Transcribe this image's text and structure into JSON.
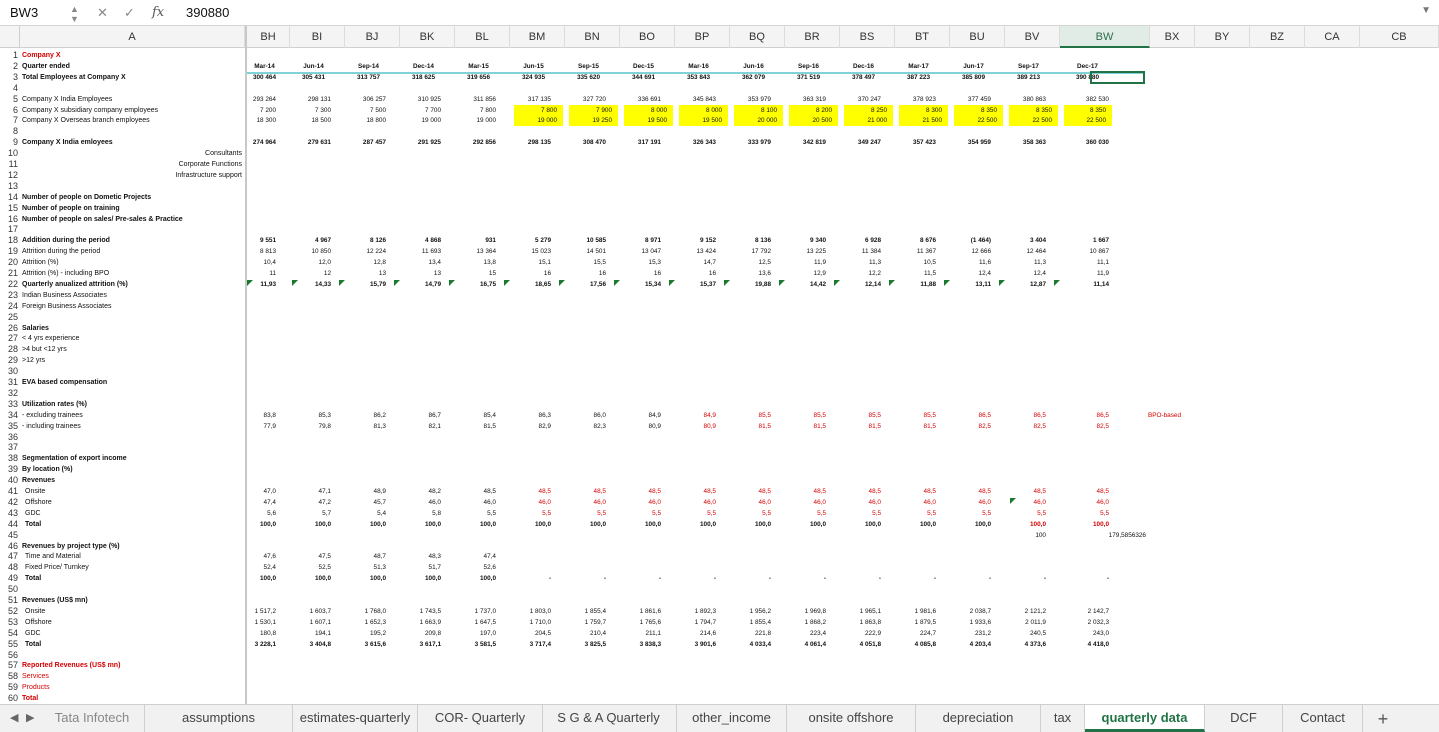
{
  "formula_bar": {
    "name_box": "BW3",
    "formula_value": "390880",
    "fx_label": "fx"
  },
  "columns": [
    "A",
    "BH",
    "BI",
    "BJ",
    "BK",
    "BL",
    "BM",
    "BN",
    "BO",
    "BP",
    "BQ",
    "BR",
    "BS",
    "BT",
    "BU",
    "BV",
    "BW",
    "BX",
    "BY",
    "BZ",
    "CA",
    "CB"
  ],
  "selected_column": "BW",
  "rows": [
    {
      "n": "1",
      "label": "Company X",
      "lstyle": "bold red",
      "v": []
    },
    {
      "n": "2",
      "label": "Quarter ended",
      "lstyle": "bold",
      "vstyle": "bold ctr",
      "v": [
        "Mar-14",
        "Jun-14",
        "Sep-14",
        "Dec-14",
        "Mar-15",
        "Jun-15",
        "Sep-15",
        "Dec-15",
        "Mar-16",
        "Jun-16",
        "Sep-16",
        "Dec-16",
        "Mar-17",
        "Jun-17",
        "Sep-17",
        "Dec-17"
      ]
    },
    {
      "n": "3",
      "label": "Total Employees at Company X",
      "lstyle": "bold",
      "vstyle": "bold ctr",
      "v": [
        "300 464",
        "305 431",
        "313 757",
        "318 625",
        "319 656",
        "324 935",
        "335 620",
        "344 691",
        "353 843",
        "362 079",
        "371 519",
        "378 497",
        "387 223",
        "385 809",
        "389 213",
        "390 880"
      ]
    },
    {
      "n": "4",
      "label": "",
      "v": []
    },
    {
      "n": "5",
      "label": "Company X India Employees",
      "v": [
        "293 264",
        "298 131",
        "306 257",
        "310 925",
        "311 856",
        "317 135",
        "327 720",
        "336 691",
        "345 843",
        "353 979",
        "363 319",
        "370 247",
        "378 923",
        "377 459",
        "380 863",
        "382 530"
      ]
    },
    {
      "n": "6",
      "label": "Company X subsidiary company employees",
      "v": [
        "7 200",
        "7 300",
        "7 500",
        "7 700",
        "7 800",
        "7 800",
        "7 900",
        "8 000",
        "8 000",
        "8 100",
        "8 200",
        "8 250",
        "8 300",
        "8 350",
        "8 350",
        "8 350"
      ],
      "yel_from": 5
    },
    {
      "n": "7",
      "label": "Company X Overseas branch employees",
      "v": [
        "18 300",
        "18 500",
        "18 800",
        "19 000",
        "19 000",
        "19 000",
        "19 250",
        "19 500",
        "19 500",
        "20 000",
        "20 500",
        "21 000",
        "21 500",
        "22 500",
        "22 500",
        "22 500"
      ],
      "yel_from": 5
    },
    {
      "n": "8",
      "label": "",
      "v": []
    },
    {
      "n": "9",
      "label": "Company X India emloyees",
      "lstyle": "bold",
      "vstyle": "bold",
      "v": [
        "274 964",
        "279 631",
        "287 457",
        "291 925",
        "292 856",
        "298 135",
        "308 470",
        "317 191",
        "326 343",
        "333 979",
        "342 819",
        "349 247",
        "357 423",
        "354 959",
        "358 363",
        "360 030"
      ]
    },
    {
      "n": "10",
      "label": "Consultants",
      "lstyle": "right",
      "v": []
    },
    {
      "n": "11",
      "label": "Corporate Functions",
      "lstyle": "right",
      "v": []
    },
    {
      "n": "12",
      "label": "Infrastructure support",
      "lstyle": "right",
      "v": []
    },
    {
      "n": "13",
      "label": "",
      "v": []
    },
    {
      "n": "14",
      "label": "Number of people on Dometic Projects",
      "lstyle": "bold",
      "v": []
    },
    {
      "n": "15",
      "label": "Number of people on training",
      "lstyle": "bold",
      "v": []
    },
    {
      "n": "16",
      "label": "Number of people on sales/ Pre-sales & Practice",
      "lstyle": "bold",
      "v": []
    },
    {
      "n": "17",
      "label": "",
      "v": []
    },
    {
      "n": "18",
      "label": "Addition during the period",
      "lstyle": "bold",
      "vstyle": "bold",
      "v": [
        "9 551",
        "4 967",
        "8 126",
        "4 868",
        "931",
        "5 279",
        "10 585",
        "8 971",
        "9 152",
        "8 136",
        "9 340",
        "6 928",
        "8 676",
        "(1 464)",
        "3 404",
        "1 667"
      ]
    },
    {
      "n": "19",
      "label": "Attrition during the period",
      "v": [
        "8 813",
        "10 850",
        "12 224",
        "11 693",
        "13 364",
        "15 023",
        "14 501",
        "13 047",
        "13 424",
        "17 792",
        "13 225",
        "11 384",
        "11 367",
        "12 666",
        "12 464",
        "10 867"
      ]
    },
    {
      "n": "20",
      "label": "Attrition (%)",
      "v": [
        "10,4",
        "12,0",
        "12,8",
        "13,4",
        "13,8",
        "15,1",
        "15,5",
        "15,3",
        "14,7",
        "12,5",
        "11,9",
        "11,3",
        "10,5",
        "11,6",
        "11,3",
        "11,1"
      ]
    },
    {
      "n": "21",
      "label": "Attrition (%) - including BPO",
      "v": [
        "11",
        "12",
        "13",
        "13",
        "15",
        "16",
        "16",
        "16",
        "16",
        "13,6",
        "12,9",
        "12,2",
        "11,5",
        "12,4",
        "12,4",
        "11,9"
      ]
    },
    {
      "n": "22",
      "label": "Quarterly anualized attrition (%)",
      "lstyle": "bold",
      "vstyle": "bold",
      "v": [
        "11,93",
        "14,33",
        "15,79",
        "14,79",
        "16,75",
        "18,65",
        "17,56",
        "15,34",
        "15,37",
        "19,88",
        "14,42",
        "12,14",
        "11,88",
        "13,11",
        "12,87",
        "11,14"
      ],
      "tri": true
    },
    {
      "n": "23",
      "label": "Indian Business Associates",
      "v": []
    },
    {
      "n": "24",
      "label": "Foreign Business Associates",
      "v": []
    },
    {
      "n": "25",
      "label": "",
      "v": []
    },
    {
      "n": "26",
      "label": "Salaries",
      "lstyle": "bold",
      "v": []
    },
    {
      "n": "27",
      "label": "< 4 yrs experience",
      "v": []
    },
    {
      "n": "28",
      "label": ">4 but <12 yrs",
      "v": []
    },
    {
      "n": "29",
      "label": ">12 yrs",
      "v": []
    },
    {
      "n": "30",
      "label": "",
      "v": []
    },
    {
      "n": "31",
      "label": "EVA based compensation",
      "lstyle": "bold",
      "v": []
    },
    {
      "n": "32",
      "label": "",
      "v": []
    },
    {
      "n": "33",
      "label": "Utilization rates (%)",
      "lstyle": "bold",
      "v": []
    },
    {
      "n": "34",
      "label": " - excluding trainees",
      "v": [
        "83,8",
        "85,3",
        "86,2",
        "86,7",
        "85,4",
        "86,3",
        "86,0",
        "84,9",
        "84,9",
        "85,5",
        "85,5",
        "85,5",
        "85,5",
        "86,5",
        "86,5",
        "86,5"
      ],
      "red_from": 8,
      "extra": "BPO-based"
    },
    {
      "n": "35",
      "label": " - including trainees",
      "v": [
        "77,9",
        "79,8",
        "81,3",
        "82,1",
        "81,5",
        "82,9",
        "82,3",
        "80,9",
        "80,9",
        "81,5",
        "81,5",
        "81,5",
        "81,5",
        "82,5",
        "82,5",
        "82,5"
      ],
      "red_from": 8
    },
    {
      "n": "36",
      "label": "",
      "v": []
    },
    {
      "n": "37",
      "label": "",
      "v": []
    },
    {
      "n": "38",
      "label": "Segmentation of export income",
      "lstyle": "bold",
      "v": []
    },
    {
      "n": "39",
      "label": "By location (%)",
      "lstyle": "bold",
      "v": []
    },
    {
      "n": "40",
      "label": "Revenues",
      "lstyle": "bold",
      "v": []
    },
    {
      "n": "41",
      "label": "Onsite",
      "lstyle": "ind",
      "v": [
        "47,0",
        "47,1",
        "48,9",
        "48,2",
        "48,5",
        "48,5",
        "48,5",
        "48,5",
        "48,5",
        "48,5",
        "48,5",
        "48,5",
        "48,5",
        "48,5",
        "48,5",
        "48,5"
      ],
      "red_from": 5
    },
    {
      "n": "42",
      "label": "Offshore",
      "lstyle": "ind",
      "v": [
        "47,4",
        "47,2",
        "45,7",
        "46,0",
        "46,0",
        "46,0",
        "46,0",
        "46,0",
        "46,0",
        "46,0",
        "46,0",
        "46,0",
        "46,0",
        "46,0",
        "46,0",
        "46,0"
      ],
      "red_from": 5
    },
    {
      "n": "43",
      "label": "GDC",
      "lstyle": "ind",
      "v": [
        "5,6",
        "5,7",
        "5,4",
        "5,8",
        "5,5",
        "5,5",
        "5,5",
        "5,5",
        "5,5",
        "5,5",
        "5,5",
        "5,5",
        "5,5",
        "5,5",
        "5,5",
        "5,5"
      ],
      "red_from": 5
    },
    {
      "n": "44",
      "label": "Total",
      "lstyle": "bold ind",
      "vstyle": "bold",
      "v": [
        "100,0",
        "100,0",
        "100,0",
        "100,0",
        "100,0",
        "100,0",
        "100,0",
        "100,0",
        "100,0",
        "100,0",
        "100,0",
        "100,0",
        "100,0",
        "100,0",
        "100,0",
        "100,0"
      ],
      "red_from": 14
    },
    {
      "n": "45",
      "label": "",
      "v": [
        "",
        "",
        "",
        "",
        "",
        "",
        "",
        "",
        "",
        "",
        "",
        "",
        "",
        "",
        "100",
        "179,5856326"
      ]
    },
    {
      "n": "46",
      "label": "Revenues by project type (%)",
      "lstyle": "bold",
      "v": []
    },
    {
      "n": "47",
      "label": "Time and Material",
      "lstyle": "ind",
      "v": [
        "47,6",
        "47,5",
        "48,7",
        "48,3",
        "47,4"
      ]
    },
    {
      "n": "48",
      "label": "Fixed Price/ Turnkey",
      "lstyle": "ind",
      "v": [
        "52,4",
        "52,5",
        "51,3",
        "51,7",
        "52,6"
      ]
    },
    {
      "n": "49",
      "label": "Total",
      "lstyle": "bold ind",
      "vstyle": "bold",
      "v": [
        "100,0",
        "100,0",
        "100,0",
        "100,0",
        "100,0",
        "-",
        "-",
        "-",
        "-",
        "-",
        "-",
        "-",
        "-",
        "-",
        "-",
        "-"
      ]
    },
    {
      "n": "50",
      "label": "",
      "v": []
    },
    {
      "n": "51",
      "label": "Revenues (US$ mn)",
      "lstyle": "bold",
      "v": []
    },
    {
      "n": "52",
      "label": "Onsite",
      "lstyle": "ind",
      "v": [
        "1 517,2",
        "1 603,7",
        "1 768,0",
        "1 743,5",
        "1 737,0",
        "1 803,0",
        "1 855,4",
        "1 861,6",
        "1 892,3",
        "1 956,2",
        "1 969,8",
        "1 965,1",
        "1 981,6",
        "2 038,7",
        "2 121,2",
        "2 142,7"
      ]
    },
    {
      "n": "53",
      "label": "Offshore",
      "lstyle": "ind",
      "v": [
        "1 530,1",
        "1 607,1",
        "1 652,3",
        "1 663,9",
        "1 647,5",
        "1 710,0",
        "1 759,7",
        "1 765,6",
        "1 794,7",
        "1 855,4",
        "1 868,2",
        "1 863,8",
        "1 879,5",
        "1 933,6",
        "2 011,9",
        "2 032,3"
      ]
    },
    {
      "n": "54",
      "label": "GDC",
      "lstyle": "ind",
      "v": [
        "180,8",
        "194,1",
        "195,2",
        "209,8",
        "197,0",
        "204,5",
        "210,4",
        "211,1",
        "214,6",
        "221,8",
        "223,4",
        "222,9",
        "224,7",
        "231,2",
        "240,5",
        "243,0"
      ]
    },
    {
      "n": "55",
      "label": "Total",
      "lstyle": "bold ind",
      "vstyle": "bold",
      "v": [
        "3 228,1",
        "3 404,8",
        "3 615,6",
        "3 617,1",
        "3 581,5",
        "3 717,4",
        "3 825,5",
        "3 838,3",
        "3 901,6",
        "4 033,4",
        "4 061,4",
        "4 051,8",
        "4 085,8",
        "4 203,4",
        "4 373,6",
        "4 418,0"
      ]
    },
    {
      "n": "56",
      "label": "",
      "v": []
    },
    {
      "n": "57",
      "label": "Reported Revenues (US$ mn)",
      "lstyle": "bold red",
      "v": []
    },
    {
      "n": "58",
      "label": "Services",
      "lstyle": "red",
      "v": []
    },
    {
      "n": "59",
      "label": "Products",
      "lstyle": "red",
      "v": []
    },
    {
      "n": "60",
      "label": "Total",
      "lstyle": "bold red",
      "v": []
    }
  ],
  "sheet_tabs": [
    {
      "label": "Tata Infotech",
      "active": false
    },
    {
      "label": "assumptions",
      "active": false
    },
    {
      "label": "estimates-quarterly",
      "active": false
    },
    {
      "label": "COR- Quarterly",
      "active": false
    },
    {
      "label": "S G & A Quarterly",
      "active": false
    },
    {
      "label": "other_income",
      "active": false
    },
    {
      "label": "onsite offshore",
      "active": false
    },
    {
      "label": "depreciation",
      "active": false
    },
    {
      "label": "tax",
      "active": false
    },
    {
      "label": "quarterly data",
      "active": true
    },
    {
      "label": "DCF",
      "active": false
    },
    {
      "label": "Contact",
      "active": false
    }
  ],
  "add_sheet_label": "+",
  "icons": [
    "dropdown-stepper-icon",
    "cancel-x-icon",
    "confirm-check-icon",
    "function-fx-icon",
    "collapse-chevron-icon",
    "prev-sheet-icon",
    "next-sheet-icon",
    "add-sheet-icon"
  ]
}
